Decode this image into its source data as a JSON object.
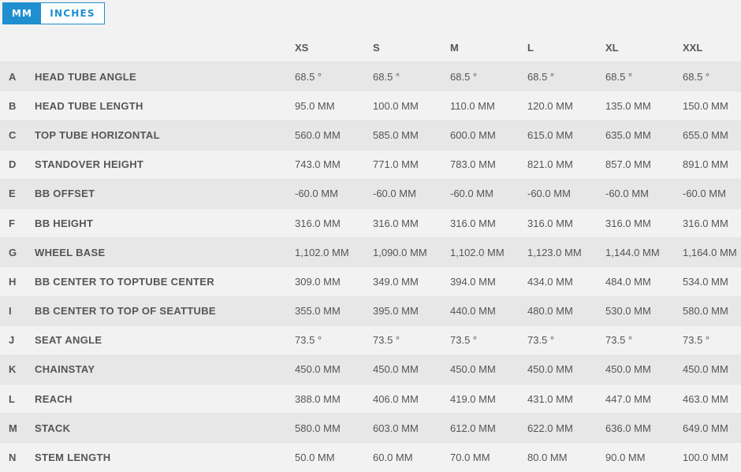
{
  "units": {
    "mm_label": "MM",
    "inches_label": "INCHES",
    "selected": "MM"
  },
  "sizes": [
    "XS",
    "S",
    "M",
    "L",
    "XL",
    "XXL"
  ],
  "rows": [
    {
      "letter": "A",
      "label": "HEAD TUBE ANGLE",
      "values": [
        "68.5 °",
        "68.5 °",
        "68.5 °",
        "68.5 °",
        "68.5 °",
        "68.5 °"
      ]
    },
    {
      "letter": "B",
      "label": "HEAD TUBE LENGTH",
      "values": [
        "95.0 MM",
        "100.0 MM",
        "110.0 MM",
        "120.0 MM",
        "135.0 MM",
        "150.0 MM"
      ]
    },
    {
      "letter": "C",
      "label": "TOP TUBE HORIZONTAL",
      "values": [
        "560.0 MM",
        "585.0 MM",
        "600.0 MM",
        "615.0 MM",
        "635.0 MM",
        "655.0 MM"
      ]
    },
    {
      "letter": "D",
      "label": "STANDOVER HEIGHT",
      "values": [
        "743.0 MM",
        "771.0 MM",
        "783.0 MM",
        "821.0 MM",
        "857.0 MM",
        "891.0 MM"
      ]
    },
    {
      "letter": "E",
      "label": "BB OFFSET",
      "values": [
        "-60.0 MM",
        "-60.0 MM",
        "-60.0 MM",
        "-60.0 MM",
        "-60.0 MM",
        "-60.0 MM"
      ]
    },
    {
      "letter": "F",
      "label": "BB HEIGHT",
      "values": [
        "316.0 MM",
        "316.0 MM",
        "316.0 MM",
        "316.0 MM",
        "316.0 MM",
        "316.0 MM"
      ]
    },
    {
      "letter": "G",
      "label": "WHEEL BASE",
      "values": [
        "1,102.0 MM",
        "1,090.0 MM",
        "1,102.0 MM",
        "1,123.0 MM",
        "1,144.0 MM",
        "1,164.0 MM"
      ]
    },
    {
      "letter": "H",
      "label": "BB CENTER TO TOPTUBE CENTER",
      "values": [
        "309.0 MM",
        "349.0 MM",
        "394.0 MM",
        "434.0 MM",
        "484.0 MM",
        "534.0 MM"
      ]
    },
    {
      "letter": "I",
      "label": "BB CENTER TO TOP OF SEATTUBE",
      "values": [
        "355.0 MM",
        "395.0 MM",
        "440.0 MM",
        "480.0 MM",
        "530.0 MM",
        "580.0 MM"
      ]
    },
    {
      "letter": "J",
      "label": "SEAT ANGLE",
      "values": [
        "73.5 °",
        "73.5 °",
        "73.5 °",
        "73.5 °",
        "73.5 °",
        "73.5 °"
      ]
    },
    {
      "letter": "K",
      "label": "CHAINSTAY",
      "values": [
        "450.0 MM",
        "450.0 MM",
        "450.0 MM",
        "450.0 MM",
        "450.0 MM",
        "450.0 MM"
      ]
    },
    {
      "letter": "L",
      "label": "REACH",
      "values": [
        "388.0 MM",
        "406.0 MM",
        "419.0 MM",
        "431.0 MM",
        "447.0 MM",
        "463.0 MM"
      ]
    },
    {
      "letter": "M",
      "label": "STACK",
      "values": [
        "580.0 MM",
        "603.0 MM",
        "612.0 MM",
        "622.0 MM",
        "636.0 MM",
        "649.0 MM"
      ]
    },
    {
      "letter": "N",
      "label": "STEM LENGTH",
      "values": [
        "50.0 MM",
        "60.0 MM",
        "70.0 MM",
        "80.0 MM",
        "90.0 MM",
        "100.0 MM"
      ]
    }
  ]
}
